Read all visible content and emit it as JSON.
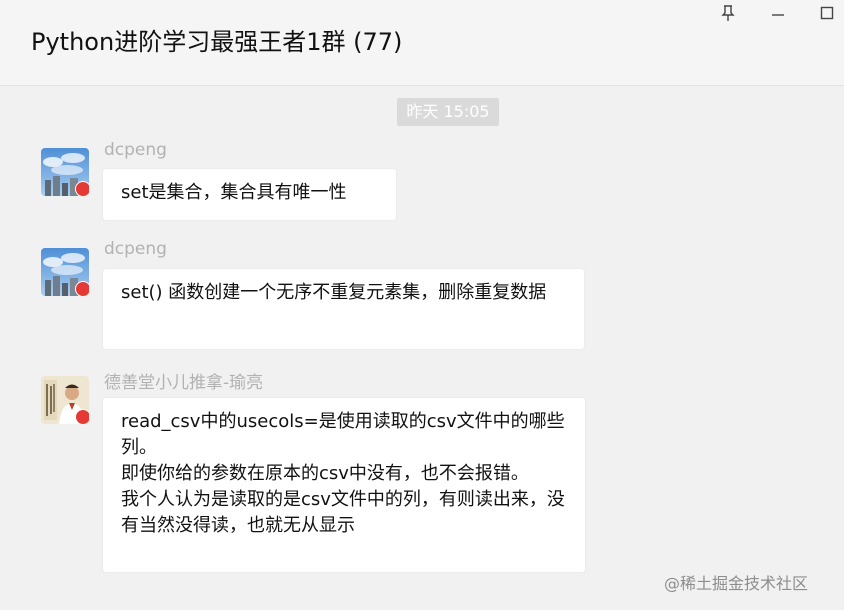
{
  "window": {
    "title": "Python进阶学习最强王者1群 (77)",
    "pin_icon": "pin-icon",
    "minimize_icon": "minimize-icon",
    "maximize_icon": "maximize-icon"
  },
  "chat": {
    "timestamp": "昨天 15:05",
    "messages": [
      {
        "sender": "dcpeng",
        "avatar": "sky-buildings-avatar",
        "text": "set是集合，集合具有唯一性"
      },
      {
        "sender": "dcpeng",
        "avatar": "sky-buildings-avatar",
        "text": "set() 函数创建一个无序不重复元素集，删除重复数据"
      },
      {
        "sender": "德善堂小儿推拿-瑜亮",
        "avatar": "person-calligraphy-avatar",
        "text": "read_csv中的usecols=是使用读取的csv文件中的哪些列。\n即使你给的参数在原本的csv中没有，也不会报错。\n我个人认为是读取的是csv文件中的列，有则读出来，没有当然没得读，也就无从显示"
      }
    ]
  },
  "watermark": "@稀土掘金技术社区",
  "colors": {
    "background": "#f1f1f1",
    "bubble": "#ffffff",
    "timestamp_bg": "#dadada",
    "name": "#b2b2b2",
    "badge": "#e53935"
  }
}
